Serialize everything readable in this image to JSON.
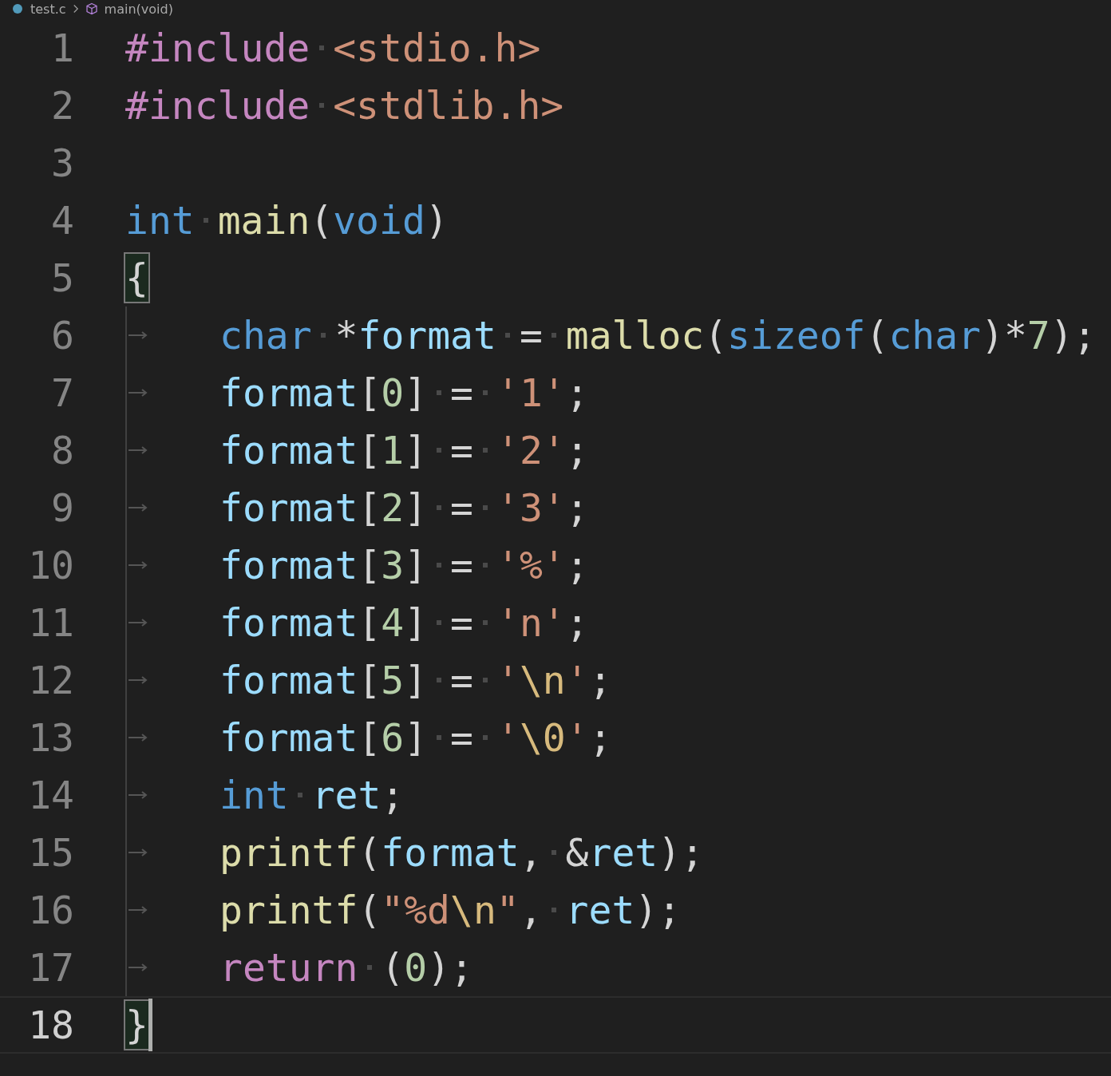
{
  "breadcrumb": [
    {
      "kind": "file",
      "label": "test.c"
    },
    {
      "kind": "symbol",
      "label": "main(void)"
    }
  ],
  "lines": [
    {
      "number": "1",
      "current": false,
      "cursor": false,
      "tokens": [
        {
          "kind": "preproc",
          "text": "#include"
        },
        {
          "kind": "space"
        },
        {
          "kind": "string",
          "text": "<stdio.h>"
        }
      ]
    },
    {
      "number": "2",
      "current": false,
      "cursor": false,
      "tokens": [
        {
          "kind": "preproc",
          "text": "#include"
        },
        {
          "kind": "space"
        },
        {
          "kind": "string",
          "text": "<stdlib.h>"
        }
      ]
    },
    {
      "number": "3",
      "current": false,
      "cursor": false
    },
    {
      "number": "4",
      "current": false,
      "cursor": false,
      "tokens": [
        {
          "kind": "keyword",
          "text": "int"
        },
        {
          "kind": "space"
        },
        {
          "kind": "func",
          "text": "main"
        },
        {
          "kind": "punct",
          "text": "("
        },
        {
          "kind": "keyword",
          "text": "void"
        },
        {
          "kind": "punct",
          "text": ")"
        }
      ]
    },
    {
      "number": "5",
      "current": false,
      "cursor": false,
      "tokens": [
        {
          "kind": "punct",
          "text": "{",
          "matched": true
        }
      ]
    },
    {
      "number": "6",
      "current": false,
      "cursor": false,
      "tokens": [
        {
          "kind": "tab"
        },
        {
          "kind": "keyword",
          "text": "char"
        },
        {
          "kind": "space"
        },
        {
          "kind": "punct",
          "text": "*"
        },
        {
          "kind": "var",
          "text": "format"
        },
        {
          "kind": "space"
        },
        {
          "kind": "punct",
          "text": "="
        },
        {
          "kind": "space"
        },
        {
          "kind": "func",
          "text": "malloc"
        },
        {
          "kind": "punct",
          "text": "("
        },
        {
          "kind": "keyword",
          "text": "sizeof"
        },
        {
          "kind": "punct",
          "text": "("
        },
        {
          "kind": "keyword",
          "text": "char"
        },
        {
          "kind": "punct",
          "text": ")*"
        },
        {
          "kind": "number",
          "text": "7"
        },
        {
          "kind": "punct",
          "text": ");"
        }
      ]
    },
    {
      "number": "7",
      "current": false,
      "cursor": false,
      "tokens": [
        {
          "kind": "tab"
        },
        {
          "kind": "var",
          "text": "format"
        },
        {
          "kind": "punct",
          "text": "["
        },
        {
          "kind": "number",
          "text": "0"
        },
        {
          "kind": "punct",
          "text": "]"
        },
        {
          "kind": "space"
        },
        {
          "kind": "punct",
          "text": "="
        },
        {
          "kind": "space"
        },
        {
          "kind": "string",
          "text": "'1'"
        },
        {
          "kind": "punct",
          "text": ";"
        }
      ]
    },
    {
      "number": "8",
      "current": false,
      "cursor": false,
      "tokens": [
        {
          "kind": "tab"
        },
        {
          "kind": "var",
          "text": "format"
        },
        {
          "kind": "punct",
          "text": "["
        },
        {
          "kind": "number",
          "text": "1"
        },
        {
          "kind": "punct",
          "text": "]"
        },
        {
          "kind": "space"
        },
        {
          "kind": "punct",
          "text": "="
        },
        {
          "kind": "space"
        },
        {
          "kind": "string",
          "text": "'2'"
        },
        {
          "kind": "punct",
          "text": ";"
        }
      ]
    },
    {
      "number": "9",
      "current": false,
      "cursor": false,
      "tokens": [
        {
          "kind": "tab"
        },
        {
          "kind": "var",
          "text": "format"
        },
        {
          "kind": "punct",
          "text": "["
        },
        {
          "kind": "number",
          "text": "2"
        },
        {
          "kind": "punct",
          "text": "]"
        },
        {
          "kind": "space"
        },
        {
          "kind": "punct",
          "text": "="
        },
        {
          "kind": "space"
        },
        {
          "kind": "string",
          "text": "'3'"
        },
        {
          "kind": "punct",
          "text": ";"
        }
      ]
    },
    {
      "number": "10",
      "current": false,
      "cursor": false,
      "tokens": [
        {
          "kind": "tab"
        },
        {
          "kind": "var",
          "text": "format"
        },
        {
          "kind": "punct",
          "text": "["
        },
        {
          "kind": "number",
          "text": "3"
        },
        {
          "kind": "punct",
          "text": "]"
        },
        {
          "kind": "space"
        },
        {
          "kind": "punct",
          "text": "="
        },
        {
          "kind": "space"
        },
        {
          "kind": "string",
          "text": "'%'"
        },
        {
          "kind": "punct",
          "text": ";"
        }
      ]
    },
    {
      "number": "11",
      "current": false,
      "cursor": false,
      "tokens": [
        {
          "kind": "tab"
        },
        {
          "kind": "var",
          "text": "format"
        },
        {
          "kind": "punct",
          "text": "["
        },
        {
          "kind": "number",
          "text": "4"
        },
        {
          "kind": "punct",
          "text": "]"
        },
        {
          "kind": "space"
        },
        {
          "kind": "punct",
          "text": "="
        },
        {
          "kind": "space"
        },
        {
          "kind": "string",
          "text": "'n'"
        },
        {
          "kind": "punct",
          "text": ";"
        }
      ]
    },
    {
      "number": "12",
      "current": false,
      "cursor": false,
      "tokens": [
        {
          "kind": "tab"
        },
        {
          "kind": "var",
          "text": "format"
        },
        {
          "kind": "punct",
          "text": "["
        },
        {
          "kind": "number",
          "text": "5"
        },
        {
          "kind": "punct",
          "text": "]"
        },
        {
          "kind": "space"
        },
        {
          "kind": "punct",
          "text": "="
        },
        {
          "kind": "space"
        },
        {
          "kind": "string",
          "text": "'"
        },
        {
          "kind": "escape",
          "text": "\\n"
        },
        {
          "kind": "string",
          "text": "'"
        },
        {
          "kind": "punct",
          "text": ";"
        }
      ]
    },
    {
      "number": "13",
      "current": false,
      "cursor": false,
      "tokens": [
        {
          "kind": "tab"
        },
        {
          "kind": "var",
          "text": "format"
        },
        {
          "kind": "punct",
          "text": "["
        },
        {
          "kind": "number",
          "text": "6"
        },
        {
          "kind": "punct",
          "text": "]"
        },
        {
          "kind": "space"
        },
        {
          "kind": "punct",
          "text": "="
        },
        {
          "kind": "space"
        },
        {
          "kind": "string",
          "text": "'"
        },
        {
          "kind": "escape",
          "text": "\\0"
        },
        {
          "kind": "string",
          "text": "'"
        },
        {
          "kind": "punct",
          "text": ";"
        }
      ]
    },
    {
      "number": "14",
      "current": false,
      "cursor": false,
      "tokens": [
        {
          "kind": "tab"
        },
        {
          "kind": "keyword",
          "text": "int"
        },
        {
          "kind": "space"
        },
        {
          "kind": "var",
          "text": "ret"
        },
        {
          "kind": "punct",
          "text": ";"
        }
      ]
    },
    {
      "number": "15",
      "current": false,
      "cursor": false,
      "tokens": [
        {
          "kind": "tab"
        },
        {
          "kind": "func",
          "text": "printf"
        },
        {
          "kind": "punct",
          "text": "("
        },
        {
          "kind": "var",
          "text": "format"
        },
        {
          "kind": "punct",
          "text": ","
        },
        {
          "kind": "space"
        },
        {
          "kind": "punct",
          "text": "&"
        },
        {
          "kind": "var",
          "text": "ret"
        },
        {
          "kind": "punct",
          "text": ");"
        }
      ]
    },
    {
      "number": "16",
      "current": false,
      "cursor": false,
      "tokens": [
        {
          "kind": "tab"
        },
        {
          "kind": "func",
          "text": "printf"
        },
        {
          "kind": "punct",
          "text": "("
        },
        {
          "kind": "string",
          "text": "\"%d"
        },
        {
          "kind": "escape",
          "text": "\\n"
        },
        {
          "kind": "string",
          "text": "\""
        },
        {
          "kind": "punct",
          "text": ","
        },
        {
          "kind": "space"
        },
        {
          "kind": "var",
          "text": "ret"
        },
        {
          "kind": "punct",
          "text": ");"
        }
      ]
    },
    {
      "number": "17",
      "current": false,
      "cursor": false,
      "tokens": [
        {
          "kind": "tab"
        },
        {
          "kind": "control",
          "text": "return"
        },
        {
          "kind": "space"
        },
        {
          "kind": "punct",
          "text": "("
        },
        {
          "kind": "number",
          "text": "0"
        },
        {
          "kind": "punct",
          "text": ");"
        }
      ]
    },
    {
      "number": "18",
      "current": true,
      "cursor": true,
      "tokens": [
        {
          "kind": "punct",
          "text": "}",
          "matched": true
        }
      ]
    }
  ]
}
